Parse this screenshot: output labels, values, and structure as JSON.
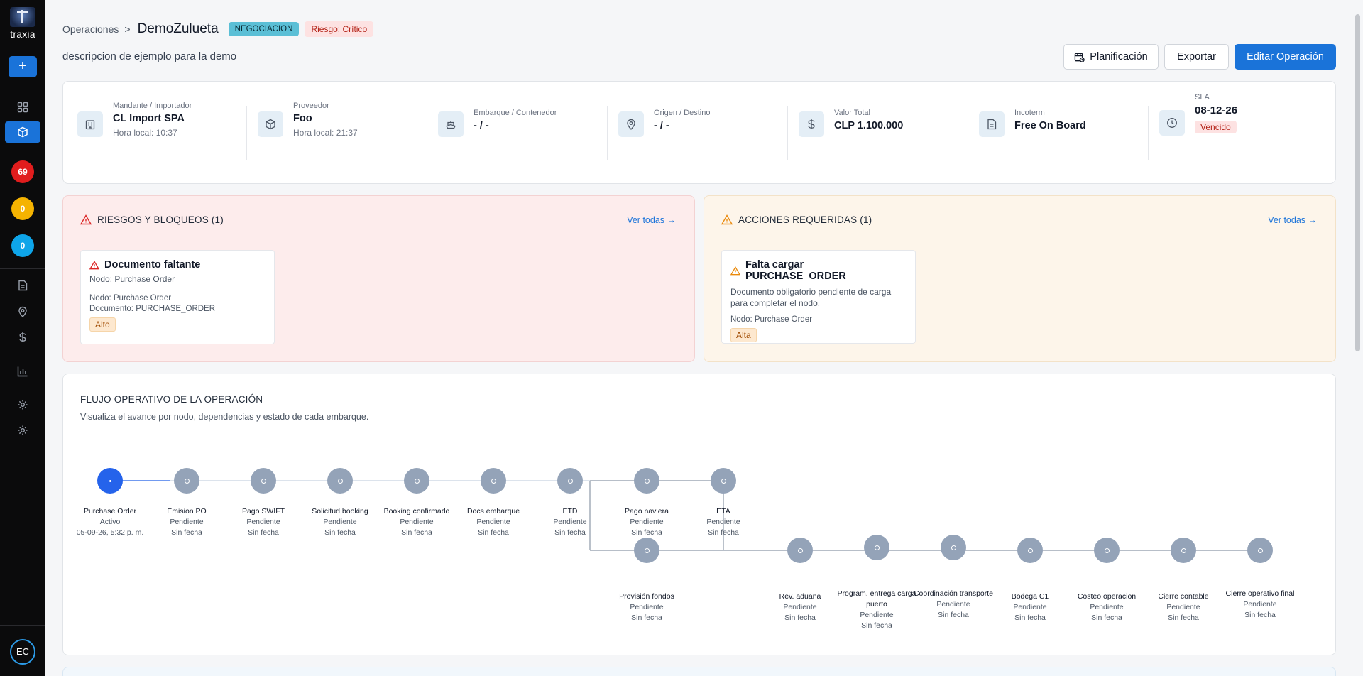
{
  "app": {
    "logo_text": "traxia",
    "avatar_initials": "EC"
  },
  "sidebar": {
    "badges": [
      {
        "count": "69",
        "color": "#e11d1d"
      },
      {
        "count": "0",
        "color": "#f5b301"
      },
      {
        "count": "0",
        "color": "#0ea5e9"
      }
    ]
  },
  "header": {
    "breadcrumb_root": "Operaciones",
    "breadcrumb_sep": ">",
    "title": "DemoZulueta",
    "status_tag": "NEGOCIACION",
    "risk_tag": "Riesgo: Crítico",
    "description": "descripcion de ejemplo para la demo"
  },
  "actions": {
    "plan_label": "Planificación",
    "export_label": "Exportar",
    "edit_label": "Editar Operación"
  },
  "info": [
    {
      "label": "Mandante / Importador",
      "value": "CL Import SPA",
      "sub": "Hora local: 10:37",
      "icon": "building-icon"
    },
    {
      "label": "Proveedor",
      "value": "Foo",
      "sub": "Hora local: 21:37",
      "icon": "box-icon"
    },
    {
      "label": "Embarque / Contenedor",
      "value": "- / -",
      "icon": "ship-icon"
    },
    {
      "label": "Origen / Destino",
      "value": "- / -",
      "icon": "location-icon"
    },
    {
      "label": "Valor Total",
      "value": "CLP 1.100.000",
      "icon": "dollar-icon"
    },
    {
      "label": "Incoterm",
      "value": "Free On Board",
      "icon": "document-icon"
    },
    {
      "label": "SLA",
      "value": "08-12-26",
      "badge": "Vencido",
      "icon": "clock-icon"
    }
  ],
  "risks": {
    "title": "RIESGOS Y BLOQUEOS (1)",
    "see_all": "Ver todas →",
    "item": {
      "title": "Documento faltante",
      "subtitle": "Nodo: Purchase Order",
      "detail_node": "Nodo: Purchase Order",
      "detail_doc": "Documento: PURCHASE_ORDER",
      "severity": "Alto"
    }
  },
  "required_actions": {
    "title": "ACCIONES REQUERIDAS (1)",
    "see_all": "Ver todas →",
    "item": {
      "title": "Falta cargar PURCHASE_ORDER",
      "description": "Documento obligatorio pendiente de carga para completar el nodo.",
      "detail_node": "Nodo: Purchase Order",
      "severity": "Alta"
    }
  },
  "flow": {
    "title": "FLUJO OPERATIVO DE LA OPERACIÓN",
    "subtitle": "Visualiza el avance por nodo, dependencias y estado de cada embarque.",
    "nodes_top": [
      {
        "name": "Purchase Order",
        "status": "Activo",
        "date": "05-09-26, 5:32 p. m.",
        "active": true
      },
      {
        "name": "Emision PO",
        "status": "Pendiente",
        "date": "Sin fecha"
      },
      {
        "name": "Pago SWIFT",
        "status": "Pendiente",
        "date": "Sin fecha"
      },
      {
        "name": "Solicitud booking",
        "status": "Pendiente",
        "date": "Sin fecha"
      },
      {
        "name": "Booking confirmado",
        "status": "Pendiente",
        "date": "Sin fecha"
      },
      {
        "name": "Docs embarque",
        "status": "Pendiente",
        "date": "Sin fecha"
      },
      {
        "name": "ETD",
        "status": "Pendiente",
        "date": "Sin fecha"
      },
      {
        "name": "Pago naviera",
        "status": "Pendiente",
        "date": "Sin fecha"
      },
      {
        "name": "ETA",
        "status": "Pendiente",
        "date": "Sin fecha"
      }
    ],
    "nodes_bottom": [
      {
        "name": "Provisión fondos",
        "status": "Pendiente",
        "date": "Sin fecha"
      },
      {
        "name": "Rev. aduana",
        "status": "Pendiente",
        "date": "Sin fecha"
      },
      {
        "name": "Program. entrega carga puerto",
        "status": "Pendiente",
        "date": "Sin fecha"
      },
      {
        "name": "Coordinación transporte",
        "status": "Pendiente",
        "date": "Sin fecha"
      },
      {
        "name": "Bodega C1",
        "status": "Pendiente",
        "date": "Sin fecha"
      },
      {
        "name": "Costeo operacion",
        "status": "Pendiente",
        "date": "Sin fecha"
      },
      {
        "name": "Cierre contable",
        "status": "Pendiente",
        "date": "Sin fecha"
      },
      {
        "name": "Cierre operativo final",
        "status": "Pendiente",
        "date": "Sin fecha"
      }
    ]
  }
}
